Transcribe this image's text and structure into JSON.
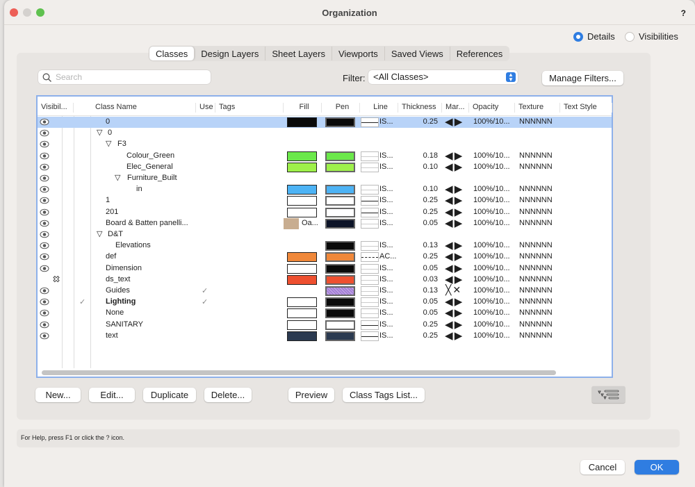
{
  "window": {
    "title": "Organization",
    "help": "?"
  },
  "view_mode": {
    "options": [
      "Details",
      "Visibilities"
    ],
    "selected": "Details"
  },
  "tabs": [
    {
      "label": "Classes",
      "selected": true
    },
    {
      "label": "Design Layers"
    },
    {
      "label": "Sheet Layers"
    },
    {
      "label": "Viewports"
    },
    {
      "label": "Saved Views"
    },
    {
      "label": "References"
    }
  ],
  "search": {
    "placeholder": "Search",
    "value": ""
  },
  "filter": {
    "label": "Filter:",
    "value": "<All Classes>",
    "manage_label": "Manage Filters..."
  },
  "columns": [
    "Visibil...",
    "Class Name",
    "Use",
    "Tags",
    "Fill",
    "Pen",
    "Line",
    "Thickness",
    "Mar...",
    "Opacity",
    "Texture",
    "Text Style"
  ],
  "rows": [
    {
      "name": "0",
      "depth": 0,
      "fill": "#0a0a0a",
      "pen": "#0a0a0a",
      "line": "IS...",
      "line_style": "solid",
      "thickness": "0.25",
      "markers": "arrows",
      "opacity": "100%/10...",
      "texture": "NNNNNN",
      "selected": true
    },
    {
      "name": "0",
      "depth": 0,
      "group": true
    },
    {
      "name": "F3",
      "depth": 1,
      "group": true
    },
    {
      "name": "Colour_Green",
      "depth": 2,
      "fill": "#6be84a",
      "pen": "#6be84a",
      "line": "IS...",
      "thickness": "0.18",
      "markers": "arrows",
      "opacity": "100%/10...",
      "texture": "NNNNNN"
    },
    {
      "name": "Elec_General",
      "depth": 2,
      "fill": "#9ef04a",
      "pen": "#9ef04a",
      "line": "IS...",
      "thickness": "0.10",
      "markers": "arrows",
      "opacity": "100%/10...",
      "texture": "NNNNNN"
    },
    {
      "name": "Furniture_Built",
      "depth": 2,
      "group": true
    },
    {
      "name": "in",
      "depth": 3,
      "fill": "#4db3f5",
      "pen": "#4db3f5",
      "line": "IS...",
      "thickness": "0.10",
      "markers": "arrows",
      "opacity": "100%/10...",
      "texture": "NNNNNN"
    },
    {
      "name": "1",
      "depth": 0,
      "fill": "#ffffff",
      "pen": "#ffffff",
      "line": "IS...",
      "line_style": "solid",
      "thickness": "0.25",
      "markers": "arrows",
      "opacity": "100%/10...",
      "texture": "NNNNNN"
    },
    {
      "name": "201",
      "depth": 0,
      "fill": "#ffffff",
      "pen": "#ffffff",
      "line": "IS...",
      "line_style": "solid",
      "thickness": "0.25",
      "markers": "arrows",
      "opacity": "100%/10...",
      "texture": "NNNNNN"
    },
    {
      "name": "Board & Batten panelli...",
      "depth": 0,
      "fill_texture": "Oa...",
      "pen": "#0d1428",
      "line": "IS...",
      "thickness": "0.05",
      "markers": "arrows",
      "opacity": "100%/10...",
      "texture": "NNNNNN"
    },
    {
      "name": "D&T",
      "depth": 0,
      "group": true
    },
    {
      "name": "Elevations",
      "depth": 1,
      "pen": "#0a0a0a",
      "line": "IS...",
      "thickness": "0.13",
      "markers": "arrows",
      "opacity": "100%/10...",
      "texture": "NNNNNN"
    },
    {
      "name": "def",
      "depth": 0,
      "fill": "#f0883a",
      "pen": "#f0883a",
      "line": "AC...",
      "line_style": "dash",
      "thickness": "0.25",
      "markers": "arrows",
      "opacity": "100%/10...",
      "texture": "NNNNNN"
    },
    {
      "name": "Dimension",
      "depth": 0,
      "fill": "#ffffff",
      "pen": "#0a0a0a",
      "line": "IS...",
      "thickness": "0.05",
      "markers": "arrows",
      "opacity": "100%/10...",
      "texture": "NNNNNN"
    },
    {
      "name": "ds_text",
      "depth": 0,
      "visibility": "invisible",
      "fill": "#ee5030",
      "pen": "#ee5030",
      "line": "IS...",
      "thickness": "0.03",
      "markers": "arrows",
      "opacity": "100%/10...",
      "texture": "NNNNNN"
    },
    {
      "name": "Guides",
      "depth": 0,
      "use": true,
      "pen": "#a47fd6",
      "pen_pattern": "hatch",
      "line": "IS...",
      "thickness": "0.13",
      "markers": "none",
      "opacity": "100%/10...",
      "texture": "NNNNNN"
    },
    {
      "name": "Lighting",
      "depth": 0,
      "active": true,
      "use": true,
      "fill": "#ffffff",
      "pen": "#0a0a0a",
      "line": "IS...",
      "thickness": "0.05",
      "markers": "arrows",
      "opacity": "100%/10...",
      "texture": "NNNNNN"
    },
    {
      "name": "None",
      "depth": 0,
      "fill": "#ffffff",
      "pen": "#0a0a0a",
      "line": "IS...",
      "thickness": "0.05",
      "markers": "arrows",
      "opacity": "100%/10...",
      "texture": "NNNNNN"
    },
    {
      "name": "SANITARY",
      "depth": 0,
      "fill": "#ffffff",
      "pen": "#ffffff",
      "line": "IS...",
      "line_style": "solid",
      "thickness": "0.25",
      "markers": "arrows",
      "opacity": "100%/10...",
      "texture": "NNNNNN"
    },
    {
      "name": "text",
      "depth": 0,
      "fill": "#2b3a50",
      "pen": "#2b3a50",
      "line": "IS...",
      "line_style": "solid",
      "thickness": "0.25",
      "markers": "arrows",
      "opacity": "100%/10...",
      "texture": "NNNNNN"
    }
  ],
  "buttons": {
    "new": "New...",
    "edit": "Edit...",
    "duplicate": "Duplicate",
    "delete": "Delete...",
    "preview": "Preview",
    "tags_list": "Class Tags List..."
  },
  "status": "For Help, press F1 or click the ? icon.",
  "footer": {
    "cancel": "Cancel",
    "ok": "OK"
  },
  "colors": {
    "accent": "#2f7de1",
    "selection": "#b8d3f8"
  }
}
